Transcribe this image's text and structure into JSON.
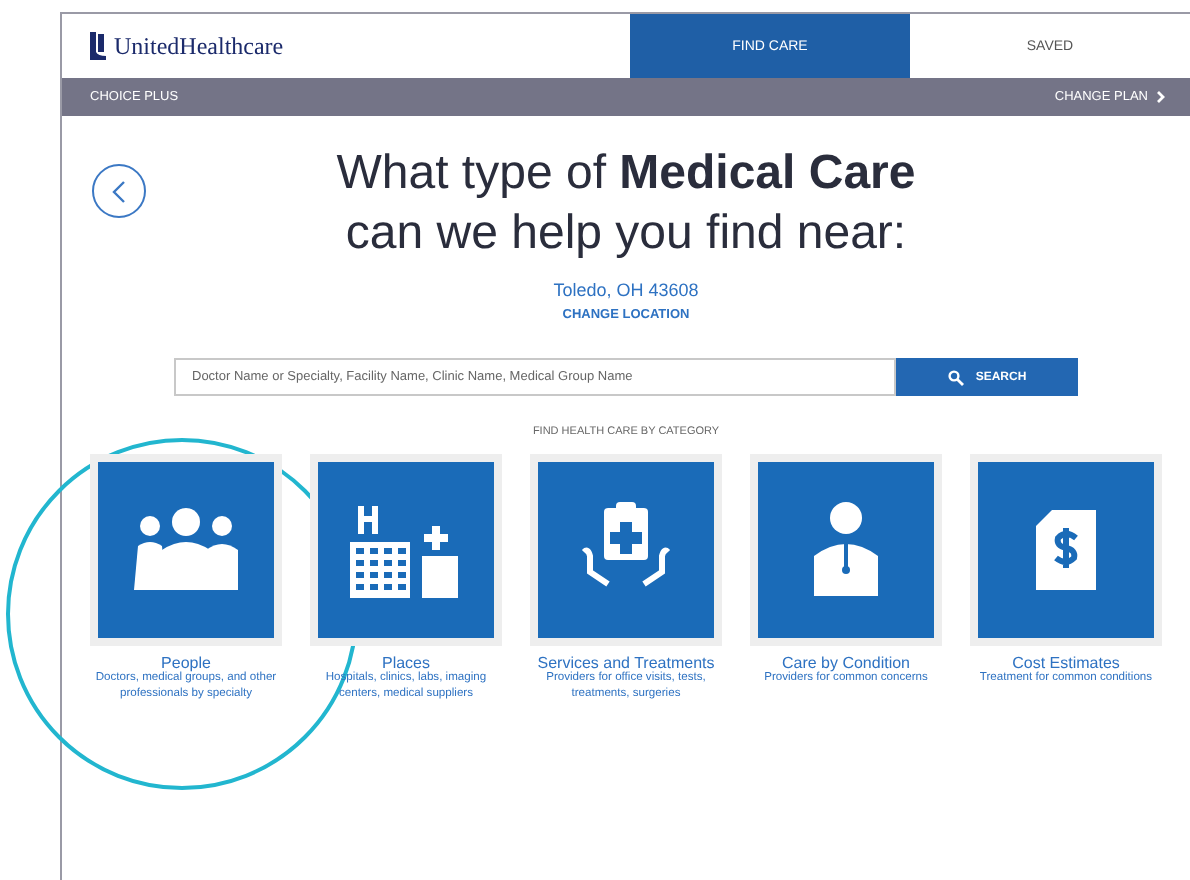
{
  "header": {
    "logo": "UnitedHealthcare",
    "tabs": [
      {
        "label": "FIND CARE",
        "selected": true
      },
      {
        "label": "SAVED",
        "selected": false
      }
    ]
  },
  "plan_bar": {
    "plan": "CHOICE PLUS",
    "change_plan": "CHANGE PLAN"
  },
  "heading": {
    "line_1": "What type of **Medical Care**",
    "line_2": "can we help you find near:"
  },
  "location": {
    "place": "Toledo, OH 43608",
    "change": "CHANGE LOCATION"
  },
  "search": {
    "placeholder": "Doctor Name or Specialty, Facility Name, Clinic Name, Medical Group Name",
    "button": "SEARCH"
  },
  "category_heading": "FIND HEALTH CARE BY CATEGORY",
  "categories": [
    {
      "kind": "people",
      "title": "People",
      "description": "Doctors, medical groups, and other professionals by specialty",
      "highlighted": true
    },
    {
      "kind": "places",
      "title": "Places",
      "description": "Hospitals, clinics, labs, imaging centers, medical suppliers",
      "highlighted": false
    },
    {
      "kind": "services",
      "title": "Services and Treatments",
      "description": "Providers for office visits, tests, treatments, surgeries",
      "highlighted": false
    },
    {
      "kind": "condition",
      "title": "Care by Condition",
      "description": "Providers for common concerns",
      "highlighted": false
    },
    {
      "kind": "cost",
      "title": "Cost Estimates",
      "description": "Treatment for common conditions",
      "highlighted": false
    }
  ]
}
